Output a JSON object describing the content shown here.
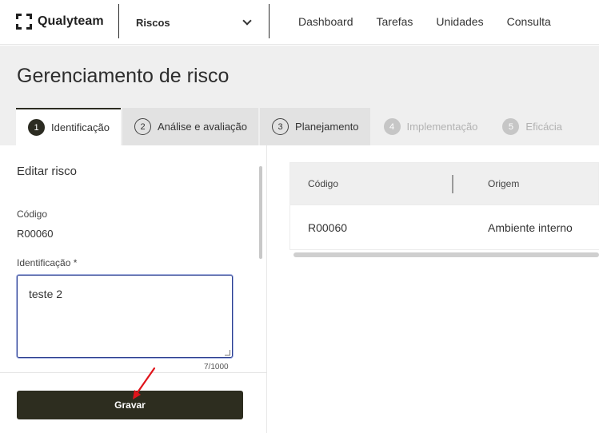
{
  "topbar": {
    "brand": "Qualyteam",
    "module": "Riscos",
    "nav": [
      "Dashboard",
      "Tarefas",
      "Unidades",
      "Consulta"
    ]
  },
  "page": {
    "title": "Gerenciamento de risco"
  },
  "steps": [
    {
      "num": "1",
      "label": "Identificação",
      "state": "active"
    },
    {
      "num": "2",
      "label": "Análise e avaliação",
      "state": "enabled"
    },
    {
      "num": "3",
      "label": "Planejamento",
      "state": "enabled"
    },
    {
      "num": "4",
      "label": "Implementação",
      "state": "disabled"
    },
    {
      "num": "5",
      "label": "Eficácia",
      "state": "disabled"
    }
  ],
  "form": {
    "section_title": "Editar risco",
    "code_label": "Código",
    "code_value": "R00060",
    "identification_label": "Identificação *",
    "identification_value": "teste 2",
    "char_count": "7/1000",
    "save_label": "Gravar"
  },
  "table": {
    "columns": [
      "Código",
      "Origem"
    ],
    "rows": [
      [
        "R00060",
        "Ambiente interno"
      ]
    ]
  },
  "colors": {
    "primary_dark": "#2d2d1f",
    "annotation_arrow": "#e0141b",
    "focus_border": "#2a3d8f"
  }
}
